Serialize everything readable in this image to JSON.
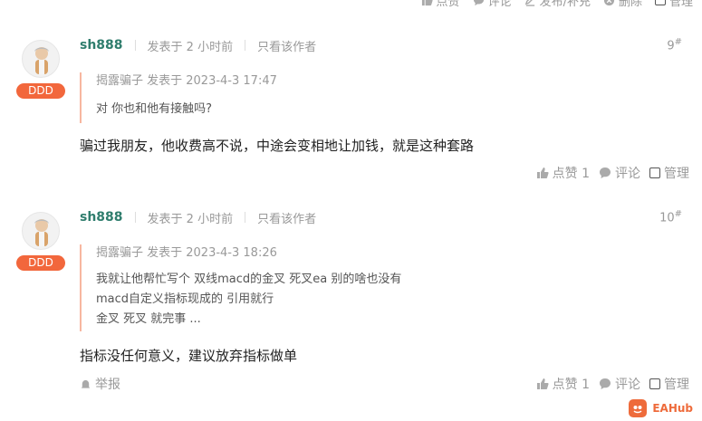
{
  "top_actions": {
    "like": "点赞",
    "comment": "评论",
    "supplement": "发布/补充",
    "delete": "删除",
    "manage": "管理"
  },
  "posts": [
    {
      "author": "sh888",
      "posted_time": "发表于 2 小时前",
      "view_author_only": "只看该作者",
      "floor": "9",
      "floor_mark": "#",
      "badge": "DDD",
      "quote_header": "揭露骗子 发表于 2023-4-3 17:47",
      "quote_lines": [
        "对 你也和他有接触吗?"
      ],
      "body": "骗过我朋友，他收费高不说，中途会变相地让加钱，就是这种套路",
      "like_label": "点赞 1",
      "comment_label": "评论",
      "manage_label": "管理"
    },
    {
      "author": "sh888",
      "posted_time": "发表于 2 小时前",
      "view_author_only": "只看该作者",
      "floor": "10",
      "floor_mark": "#",
      "badge": "DDD",
      "quote_header": "揭露骗子 发表于 2023-4-3 18:26",
      "quote_lines": [
        "我就让他帮忙写个 双线macd的金叉 死叉ea 别的啥也没有",
        "macd自定义指标现成的 引用就行",
        "金叉 死叉 就完事 ..."
      ],
      "body": "指标没任何意义，建议放弃指标做单",
      "report_label": "举报",
      "like_label": "点赞 1",
      "comment_label": "评论",
      "manage_label": "管理"
    }
  ],
  "logo_text": "EAHub",
  "colors": {
    "accent": "#f2673c",
    "author": "#2f7d6d",
    "quote_border": "#f7b7a0"
  }
}
